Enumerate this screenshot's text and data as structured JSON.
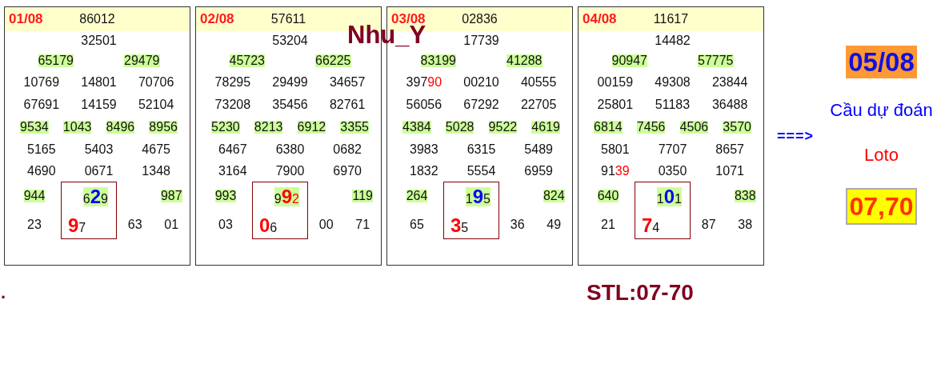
{
  "title": "Nhu_Y",
  "cards": [
    {
      "date": "01/08",
      "special": "86012",
      "first_prize": {
        "text": "32501",
        "highlighted": false
      },
      "second_prizes": [
        {
          "text": "65179",
          "highlighted": true
        },
        {
          "text": "29479",
          "highlighted": true
        }
      ],
      "rows": [
        {
          "cells": [
            {
              "text": "10769",
              "highlighted": false
            },
            {
              "text": "14801",
              "highlighted": false
            },
            {
              "text": "70706",
              "highlighted": false
            }
          ]
        },
        {
          "cells": [
            {
              "text": "67691",
              "highlighted": false
            },
            {
              "text": "14159",
              "highlighted": false
            },
            {
              "text": "52104",
              "highlighted": false
            }
          ]
        },
        {
          "cells": [
            {
              "text": "9534",
              "highlighted": true
            },
            {
              "text": "1043",
              "highlighted": true
            },
            {
              "text": "8496",
              "highlighted": true
            },
            {
              "text": "8956",
              "highlighted": true
            }
          ]
        },
        {
          "cells": [
            {
              "text": "5165",
              "highlighted": false
            },
            {
              "text": "5403",
              "highlighted": false
            },
            {
              "text": "4675",
              "highlighted": false
            }
          ]
        },
        {
          "cells": [
            {
              "text": "4690",
              "highlighted": false
            },
            {
              "text": "0671",
              "highlighted": false
            },
            {
              "text": "1348",
              "highlighted": false
            }
          ]
        }
      ],
      "bottom_rows": [
        {
          "cells": [
            {
              "text": "944",
              "highlighted": true,
              "boxed": false
            },
            {
              "parts": [
                {
                  "text": "6",
                  "kind": "plain"
                },
                {
                  "text": "2",
                  "kind": "big-blue"
                },
                {
                  "text": "9",
                  "kind": "plain"
                }
              ],
              "highlighted": true,
              "boxed": true
            },
            {
              "text": "987",
              "highlighted": true,
              "boxed": false
            }
          ]
        },
        {
          "cells": [
            {
              "text": "23",
              "highlighted": false,
              "boxed": false
            },
            {
              "parts": [
                {
                  "text": "9",
                  "kind": "big-red"
                },
                {
                  "text": "7",
                  "kind": "plain"
                }
              ],
              "highlighted": false,
              "boxed": true
            },
            {
              "text": "63",
              "highlighted": false,
              "boxed": false
            },
            {
              "text": "01",
              "highlighted": false,
              "boxed": false
            }
          ]
        }
      ]
    },
    {
      "date": "02/08",
      "special": "57611",
      "first_prize": {
        "text": "53204",
        "highlighted": false
      },
      "second_prizes": [
        {
          "text": "45723",
          "highlighted": true
        },
        {
          "text": "66225",
          "highlighted": true
        }
      ],
      "rows": [
        {
          "cells": [
            {
              "text": "78295",
              "highlighted": false
            },
            {
              "text": "29499",
              "highlighted": false
            },
            {
              "text": "34657",
              "highlighted": false
            }
          ]
        },
        {
          "cells": [
            {
              "text": "73208",
              "highlighted": false
            },
            {
              "text": "35456",
              "highlighted": false
            },
            {
              "text": "82761",
              "highlighted": false
            }
          ]
        },
        {
          "cells": [
            {
              "text": "5230",
              "highlighted": true
            },
            {
              "text": "8213",
              "highlighted": true
            },
            {
              "text": "6912",
              "highlighted": true
            },
            {
              "text": "3355",
              "highlighted": true
            }
          ]
        },
        {
          "cells": [
            {
              "text": "6467",
              "highlighted": false
            },
            {
              "text": "6380",
              "highlighted": false
            },
            {
              "text": "0682",
              "highlighted": false
            }
          ]
        },
        {
          "cells": [
            {
              "text": "3164",
              "highlighted": false
            },
            {
              "text": "7900",
              "highlighted": false
            },
            {
              "text": "6970",
              "highlighted": false
            }
          ]
        }
      ],
      "bottom_rows": [
        {
          "cells": [
            {
              "text": "993",
              "highlighted": true,
              "boxed": false
            },
            {
              "parts": [
                {
                  "text": "9",
                  "kind": "plain"
                },
                {
                  "text": "9",
                  "kind": "big-red"
                },
                {
                  "text": "2",
                  "kind": "red"
                }
              ],
              "highlighted": true,
              "boxed": true
            },
            {
              "text": "119",
              "highlighted": true,
              "boxed": false
            }
          ]
        },
        {
          "cells": [
            {
              "text": "03",
              "highlighted": false,
              "boxed": false
            },
            {
              "parts": [
                {
                  "text": "0",
                  "kind": "big-red"
                },
                {
                  "text": "6",
                  "kind": "plain"
                }
              ],
              "highlighted": false,
              "boxed": true
            },
            {
              "text": "00",
              "highlighted": false,
              "boxed": false
            },
            {
              "text": "71",
              "highlighted": false,
              "boxed": false
            }
          ]
        }
      ]
    },
    {
      "date": "03/08",
      "special": "02836",
      "first_prize": {
        "text": "17739",
        "highlighted": false
      },
      "second_prizes": [
        {
          "text": "83199",
          "highlighted": true
        },
        {
          "text": "41288",
          "highlighted": true
        }
      ],
      "rows": [
        {
          "cells": [
            {
              "parts": [
                {
                  "text": "397",
                  "kind": "plain"
                },
                {
                  "text": "90",
                  "kind": "red"
                }
              ],
              "highlighted": false
            },
            {
              "text": "00210",
              "highlighted": false
            },
            {
              "text": "40555",
              "highlighted": false
            }
          ]
        },
        {
          "cells": [
            {
              "text": "56056",
              "highlighted": false
            },
            {
              "text": "67292",
              "highlighted": false
            },
            {
              "text": "22705",
              "highlighted": false
            }
          ]
        },
        {
          "cells": [
            {
              "text": "4384",
              "highlighted": true
            },
            {
              "text": "5028",
              "highlighted": true
            },
            {
              "text": "9522",
              "highlighted": true
            },
            {
              "text": "4619",
              "highlighted": true
            }
          ]
        },
        {
          "cells": [
            {
              "text": "3983",
              "highlighted": false
            },
            {
              "text": "6315",
              "highlighted": false
            },
            {
              "text": "5489",
              "highlighted": false
            }
          ]
        },
        {
          "cells": [
            {
              "text": "1832",
              "highlighted": false
            },
            {
              "text": "5554",
              "highlighted": false
            },
            {
              "text": "6959",
              "highlighted": false
            }
          ]
        }
      ],
      "bottom_rows": [
        {
          "cells": [
            {
              "text": "264",
              "highlighted": true,
              "boxed": false
            },
            {
              "parts": [
                {
                  "text": "1",
                  "kind": "plain"
                },
                {
                  "text": "9",
                  "kind": "big-blue"
                },
                {
                  "text": "5",
                  "kind": "plain"
                }
              ],
              "highlighted": true,
              "boxed": true
            },
            {
              "text": "824",
              "highlighted": true,
              "boxed": false
            }
          ]
        },
        {
          "cells": [
            {
              "text": "65",
              "highlighted": false,
              "boxed": false
            },
            {
              "parts": [
                {
                  "text": "3",
                  "kind": "big-red"
                },
                {
                  "text": "5",
                  "kind": "plain"
                }
              ],
              "highlighted": false,
              "boxed": true
            },
            {
              "text": "36",
              "highlighted": false,
              "boxed": false
            },
            {
              "text": "49",
              "highlighted": false,
              "boxed": false
            }
          ]
        }
      ]
    },
    {
      "date": "04/08",
      "special": "11617",
      "first_prize": {
        "text": "14482",
        "highlighted": false
      },
      "second_prizes": [
        {
          "text": "90947",
          "highlighted": true
        },
        {
          "text": "57775",
          "highlighted": true
        }
      ],
      "rows": [
        {
          "cells": [
            {
              "text": "00159",
              "highlighted": false
            },
            {
              "text": "49308",
              "highlighted": false
            },
            {
              "text": "23844",
              "highlighted": false
            }
          ]
        },
        {
          "cells": [
            {
              "text": "25801",
              "highlighted": false
            },
            {
              "text": "51183",
              "highlighted": false
            },
            {
              "text": "36488",
              "highlighted": false
            }
          ]
        },
        {
          "cells": [
            {
              "text": "6814",
              "highlighted": true
            },
            {
              "text": "7456",
              "highlighted": true
            },
            {
              "text": "4506",
              "highlighted": true
            },
            {
              "text": "3570",
              "highlighted": true
            }
          ]
        },
        {
          "cells": [
            {
              "text": "5801",
              "highlighted": false
            },
            {
              "text": "7707",
              "highlighted": false
            },
            {
              "text": "8657",
              "highlighted": false
            }
          ]
        },
        {
          "cells": [
            {
              "parts": [
                {
                  "text": "91",
                  "kind": "plain"
                },
                {
                  "text": "39",
                  "kind": "red"
                }
              ],
              "highlighted": false
            },
            {
              "text": "0350",
              "highlighted": false
            },
            {
              "text": "1071",
              "highlighted": false
            }
          ]
        }
      ],
      "bottom_rows": [
        {
          "cells": [
            {
              "text": "640",
              "highlighted": true,
              "boxed": false
            },
            {
              "parts": [
                {
                  "text": "1",
                  "kind": "plain"
                },
                {
                  "text": "0",
                  "kind": "big-blue"
                },
                {
                  "text": "1",
                  "kind": "plain"
                }
              ],
              "highlighted": true,
              "boxed": true
            },
            {
              "text": "838",
              "highlighted": true,
              "boxed": false
            }
          ]
        },
        {
          "cells": [
            {
              "text": "21",
              "highlighted": false,
              "boxed": false
            },
            {
              "parts": [
                {
                  "text": "7",
                  "kind": "big-red"
                },
                {
                  "text": "4",
                  "kind": "plain"
                }
              ],
              "highlighted": false,
              "boxed": true
            },
            {
              "text": "87",
              "highlighted": false,
              "boxed": false
            },
            {
              "text": "38",
              "highlighted": false,
              "boxed": false
            }
          ]
        }
      ]
    }
  ],
  "arrow": "===>",
  "prediction": {
    "date": "05/08",
    "label": "Cầu dự đoán",
    "type": "Loto",
    "numbers": "07,70"
  },
  "footer": {
    "mark": ".",
    "summary": "STL:07-70"
  }
}
